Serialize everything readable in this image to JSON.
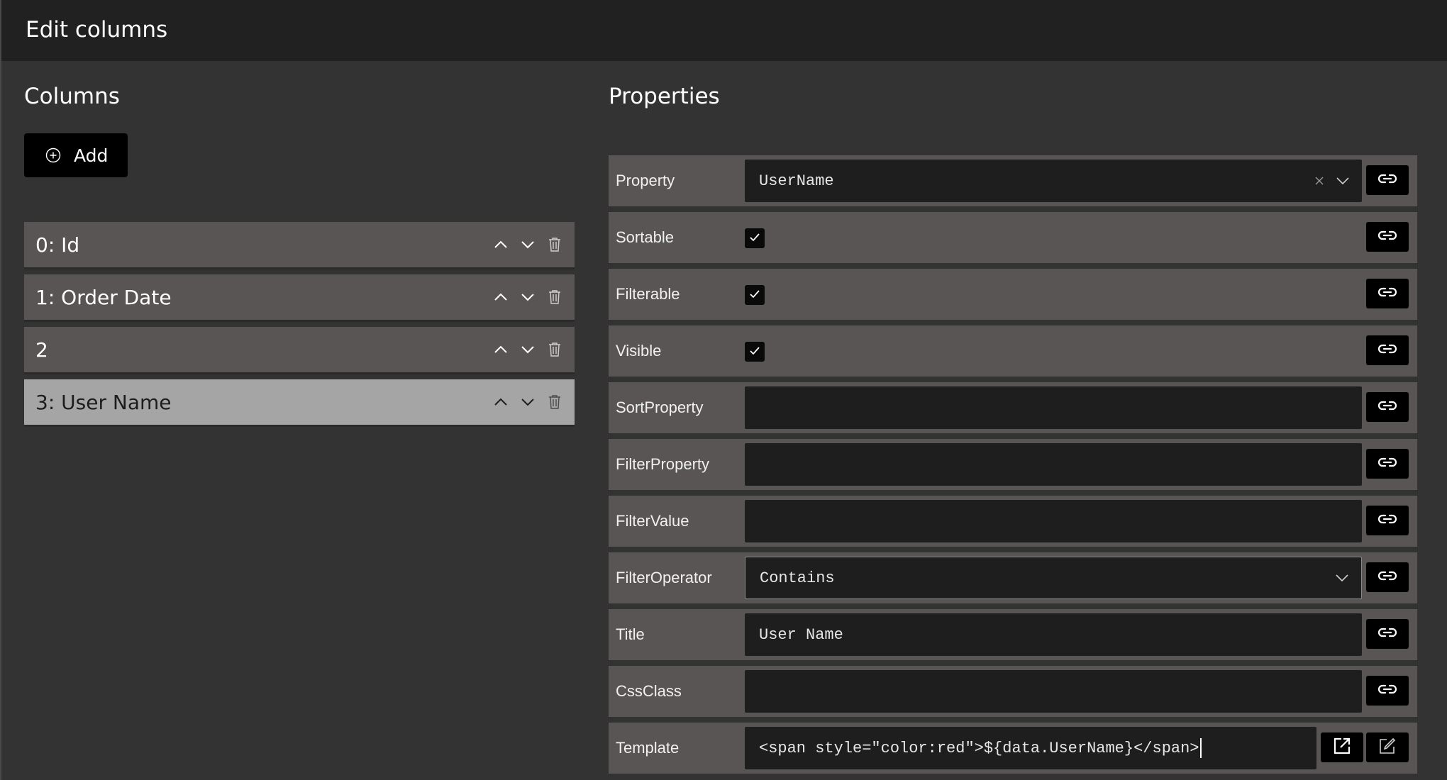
{
  "window": {
    "title": "Edit columns"
  },
  "columns_panel": {
    "heading": "Columns",
    "add_label": "Add",
    "items": [
      {
        "label": "0: Id",
        "selected": false
      },
      {
        "label": "1: Order Date",
        "selected": false
      },
      {
        "label": "2",
        "selected": false
      },
      {
        "label": "3: User Name",
        "selected": true
      }
    ]
  },
  "properties_panel": {
    "heading": "Properties",
    "property": {
      "label": "Property",
      "value": "UserName"
    },
    "sortable": {
      "label": "Sortable",
      "checked": true
    },
    "filterable": {
      "label": "Filterable",
      "checked": true
    },
    "visible": {
      "label": "Visible",
      "checked": true
    },
    "sort_property": {
      "label": "SortProperty",
      "value": ""
    },
    "filter_property": {
      "label": "FilterProperty",
      "value": ""
    },
    "filter_value": {
      "label": "FilterValue",
      "value": ""
    },
    "filter_operator": {
      "label": "FilterOperator",
      "value": "Contains"
    },
    "title": {
      "label": "Title",
      "value": "User Name"
    },
    "css_class": {
      "label": "CssClass",
      "value": ""
    },
    "template": {
      "label": "Template",
      "value": "<span style=\"color:red\">${data.UserName}</span>"
    }
  },
  "icons": {
    "add": "plus-circle-icon",
    "move_up": "chevron-up-icon",
    "move_down": "chevron-down-icon",
    "delete": "trash-icon",
    "bind": "link-icon",
    "clear": "close-icon",
    "dropdown": "chevron-down-icon",
    "open_external": "open-external-icon",
    "edit": "edit-icon",
    "check": "check-icon"
  },
  "colors": {
    "background": "#333333",
    "titlebar": "#212121",
    "row": "#595555",
    "row_selected": "#a6a5a5",
    "input": "#1e1e1e",
    "button": "#000000"
  }
}
